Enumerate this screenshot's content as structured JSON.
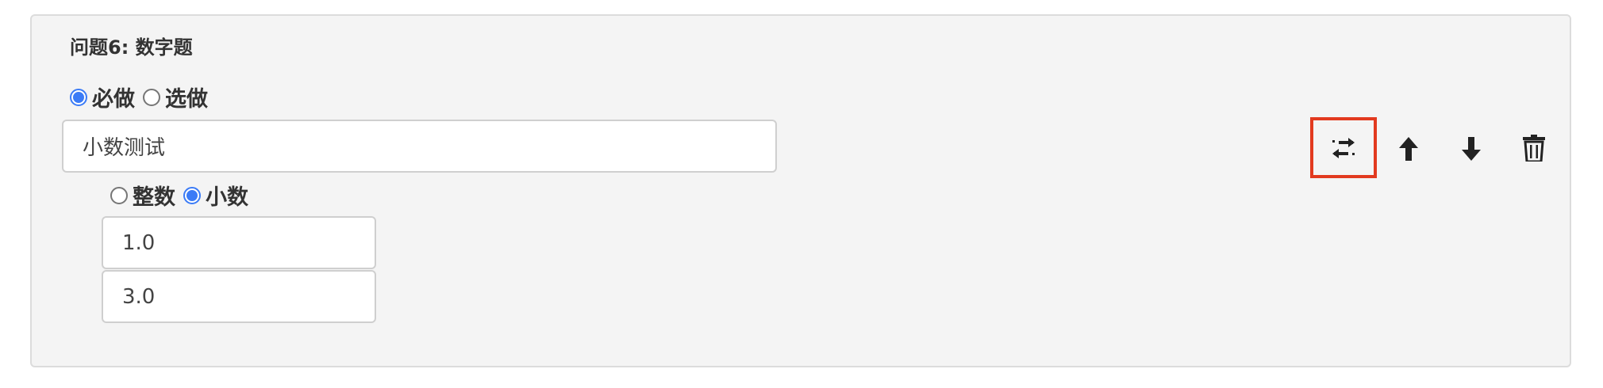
{
  "question": {
    "title": "问题6: 数字题",
    "required_options": [
      {
        "label": "必做",
        "checked": true
      },
      {
        "label": "选做",
        "checked": false
      }
    ],
    "text_value": "小数测试",
    "number_type_options": [
      {
        "label": "整数",
        "checked": false
      },
      {
        "label": "小数",
        "checked": true
      }
    ],
    "min_value": "1.0",
    "max_value": "3.0"
  },
  "toolbar": {
    "icons": [
      "swap-icon",
      "arrow-up-icon",
      "arrow-down-icon",
      "trash-icon"
    ],
    "highlight_color": "#e23a1f",
    "accent_color": "#3b7bf6"
  }
}
